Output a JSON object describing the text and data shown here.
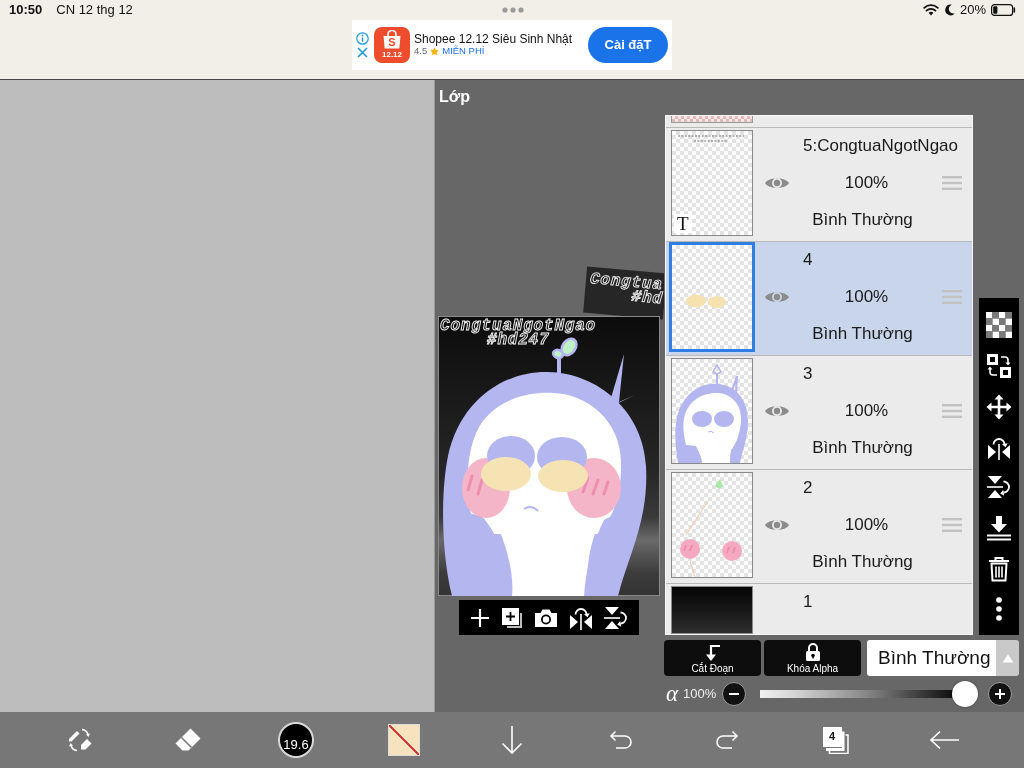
{
  "status_bar": {
    "time": "10:50",
    "date": "CN 12 thg 12",
    "battery": "20%"
  },
  "ad": {
    "icon_letter": "S",
    "icon_label": "12.12",
    "title": "Shopee 12.12 Siêu Sinh Nhật",
    "rating": "4.5",
    "price": "MIỄN PHÍ",
    "install_button": "Cài đặT"
  },
  "panel": {
    "title": "Lớp"
  },
  "canvas": {
    "text_lines": [
      "CongtuaNgotNgao",
      "#hd247"
    ],
    "ghost_lines": [
      "Congtua",
      "#hd"
    ]
  },
  "layers": [
    {
      "name": "5:CongtuaNgotNgao",
      "kind": "text",
      "badge": "T",
      "visible": true,
      "opacity": "100%",
      "blend": "Bình Thường",
      "selected": false
    },
    {
      "name": "4",
      "kind": "eyes",
      "visible": true,
      "opacity": "100%",
      "blend": "Bình Thường",
      "selected": true
    },
    {
      "name": "3",
      "kind": "outline",
      "visible": true,
      "opacity": "100%",
      "blend": "Bình Thường",
      "selected": false
    },
    {
      "name": "2",
      "kind": "cheeks",
      "visible": true,
      "opacity": "100%",
      "blend": "Bình Thường",
      "selected": false
    },
    {
      "name": "1",
      "kind": "fill",
      "selected": false
    }
  ],
  "layer_buttons": [
    {
      "kind": "clip",
      "label": "Cắt Đoạn"
    },
    {
      "kind": "alpha-lock",
      "label": "Khóa Alpha"
    }
  ],
  "blend_mode": {
    "value": "Bình Thường"
  },
  "opacity": {
    "symbol": "α",
    "reading": "100%",
    "level": 1
  },
  "bottom_toolbar": {
    "brush_size": "19.6",
    "layer_count": "4"
  }
}
